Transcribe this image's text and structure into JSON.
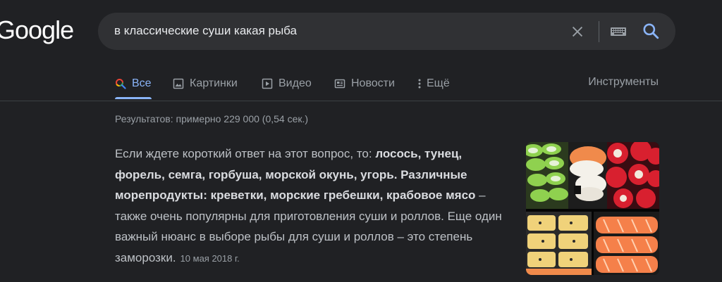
{
  "logo": {
    "text": "Google"
  },
  "search": {
    "query": "в классические суши какая рыба"
  },
  "tabs": [
    {
      "label": "Все",
      "icon": "search-icon"
    },
    {
      "label": "Картинки",
      "icon": "image-icon"
    },
    {
      "label": "Видео",
      "icon": "video-icon"
    },
    {
      "label": "Новости",
      "icon": "news-icon"
    },
    {
      "label": "Ещё",
      "icon": "more-vert-icon"
    }
  ],
  "tools_label": "Инструменты",
  "stats": "Результатов: примерно 229 000 (0,54 сек.)",
  "featured_snippet": {
    "p1": "Если ждете короткий ответ на этот вопрос, то: ",
    "b1": "лосось, тунец, форель, семга, горбуша, морской окунь, угорь. Различные морепродукты: креветки, морские гребешки, крабовое мясо",
    "p2": " – также очень популярны для приготовления суши и роллов. Еще один важный нюанс в выборе рыбы для суши и роллов – это степень заморозки.",
    "date": "10 мая 2018 г."
  },
  "colors": {
    "background": "#202124",
    "search_box": "#303134",
    "accent": "#8ab4f8",
    "text": "#bdc1c6",
    "muted": "#9aa0a6"
  }
}
